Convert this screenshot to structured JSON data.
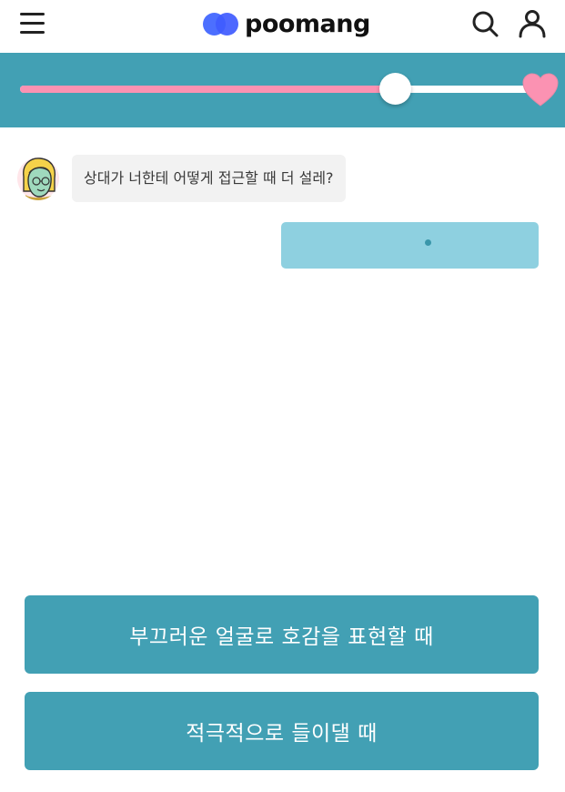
{
  "header": {
    "logo_text": "poomang",
    "icons": [
      "hamburger-menu-icon",
      "search-icon",
      "user-icon"
    ],
    "brand_color": "#4c6fff"
  },
  "progress": {
    "value": 0.73,
    "end_icon": "heart-icon",
    "band_color": "#42a0b4",
    "fill_color": "#fb92b2"
  },
  "chat": {
    "question": "상대가 너한테 어떻게 접근할 때 더 설레?",
    "reply_state": "typing"
  },
  "answers": [
    {
      "label": "부끄러운 얼굴로 호감을 표현할 때"
    },
    {
      "label": "적극적으로 들이댈 때"
    }
  ]
}
